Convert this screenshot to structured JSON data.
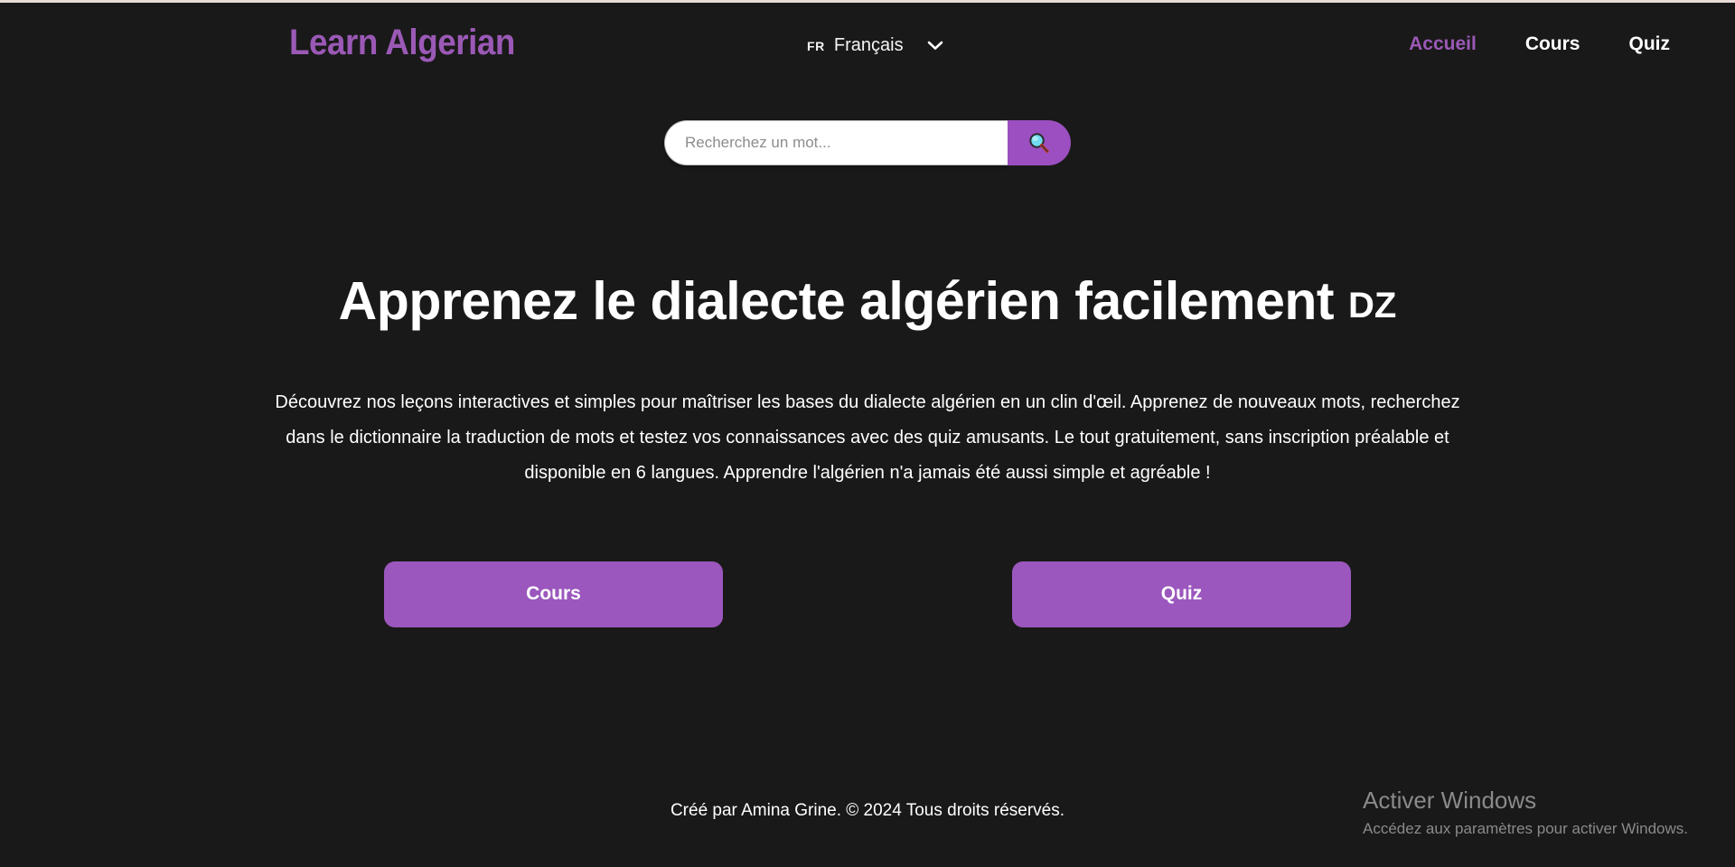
{
  "theme": {
    "background": "#191919",
    "accent": "#9b59b6",
    "button_purple": "#9b57bd",
    "search_button_purple": "#9b4fc0",
    "text": "#ffffff",
    "watermark": "#8a8a8a"
  },
  "header": {
    "brand": "Learn Algerian",
    "language": {
      "code": "FR",
      "name": "Français",
      "chevron_icon": "chevron-down-icon",
      "options": [
        "Français"
      ]
    },
    "nav": [
      {
        "label": "Accueil",
        "active": true
      },
      {
        "label": "Cours",
        "active": false
      },
      {
        "label": "Quiz",
        "active": false
      }
    ]
  },
  "search": {
    "placeholder": "Recherchez un mot...",
    "value": "",
    "button_icon": "search-icon"
  },
  "hero": {
    "title": "Apprenez le dialecte algérien facilement",
    "title_suffix": "DZ",
    "paragraph": "Découvrez nos leçons interactives et simples pour maîtriser les bases du dialecte algérien en un clin d'œil. Apprenez de nouveaux mots, recherchez dans le dictionnaire la traduction de mots et testez vos connaissances avec des quiz amusants. Le tout gratuitement, sans inscription préalable et disponible en 6 langues. Apprendre l'algérien n'a jamais été aussi simple et agréable !",
    "cta": [
      {
        "label": "Cours"
      },
      {
        "label": "Quiz"
      }
    ]
  },
  "footer": {
    "text": "Créé par Amina Grine. © 2024 Tous droits réservés."
  },
  "windows_watermark": {
    "title": "Activer Windows",
    "subtitle": "Accédez aux paramètres pour activer Windows."
  }
}
